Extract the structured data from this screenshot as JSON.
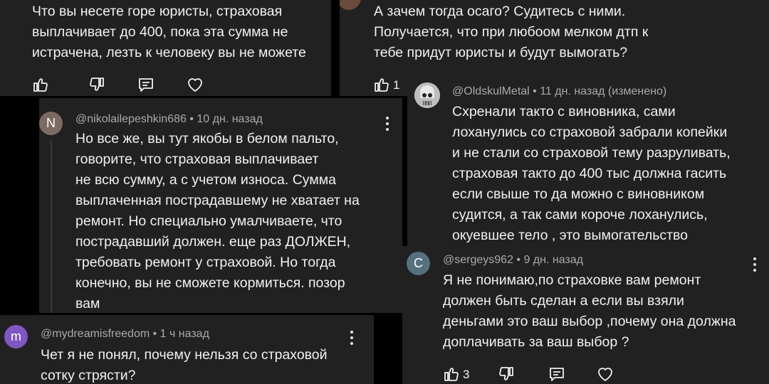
{
  "top_left": {
    "lines": [
      "Что вы несете горе юристы, страховая",
      "выплачивает до 400, пока эта сумма не",
      "истрачена, лезть к человеку вы не можете"
    ]
  },
  "top_right": {
    "lines": [
      "А зачем тогда осаго? Судитесь с ними.",
      "Получается, что при любоом мелком дтп к",
      "тебе придут юристы и будут вымогать?"
    ],
    "like_count": "1"
  },
  "nikolai": {
    "avatar_letter": "N",
    "avatar_color": "#7b6b62",
    "meta": "@nikolailepeshkin686 • 10 дн. назад",
    "lines": [
      "Но все же, вы тут якобы в белом пальто,",
      "говорите, что страховая выплачивает",
      "не всю сумму, а с учетом износа. Сумма",
      "выплаченная пострадавшему не хватает на",
      "ремонт. Но специально умалчиваете, что",
      "пострадавший должен. еще раз ДОЛЖЕН,",
      "требовать ремонт у страховой. Но тогда",
      "конечно, вы не сможете кормиться. позор",
      "вам"
    ]
  },
  "oldskul": {
    "meta": "@OldskulMetal • 11 дн. назад (изменено)",
    "lines": [
      "Схренали такто с виновника, сами",
      "лоханулись со страховой забрали копейки",
      "и не стали со страховой тему разруливать,",
      "страховая такто до 400 тыс должна гасить",
      "если свыше то да можно с виновником",
      "судится, а так сами короче лоханулись,",
      "окуевшее тело , это вымогательство"
    ]
  },
  "sergeys": {
    "avatar_letter": "C",
    "avatar_color": "#56707e",
    "meta": "@sergeys962 • 9 дн. назад",
    "lines": [
      "Я не понимаю,по страховке вам ремонт",
      "должен быть сделан а если вы взяли",
      "деньгами это ваш выбор ,почему она должна",
      "доплачивать за ваш выбор ?"
    ],
    "like_count": "3"
  },
  "mydreams": {
    "avatar_letter": "m",
    "avatar_color": "#7e57c2",
    "meta": "@mydreamisfreedom • 1 ч назад",
    "lines": [
      "Чет я не понял, почему нельзя со страховой",
      "сотку стрясти?"
    ]
  },
  "icons": [
    "thumb-up-icon",
    "thumb-down-icon",
    "reply-icon",
    "heart-icon",
    "more-vert-icon"
  ]
}
